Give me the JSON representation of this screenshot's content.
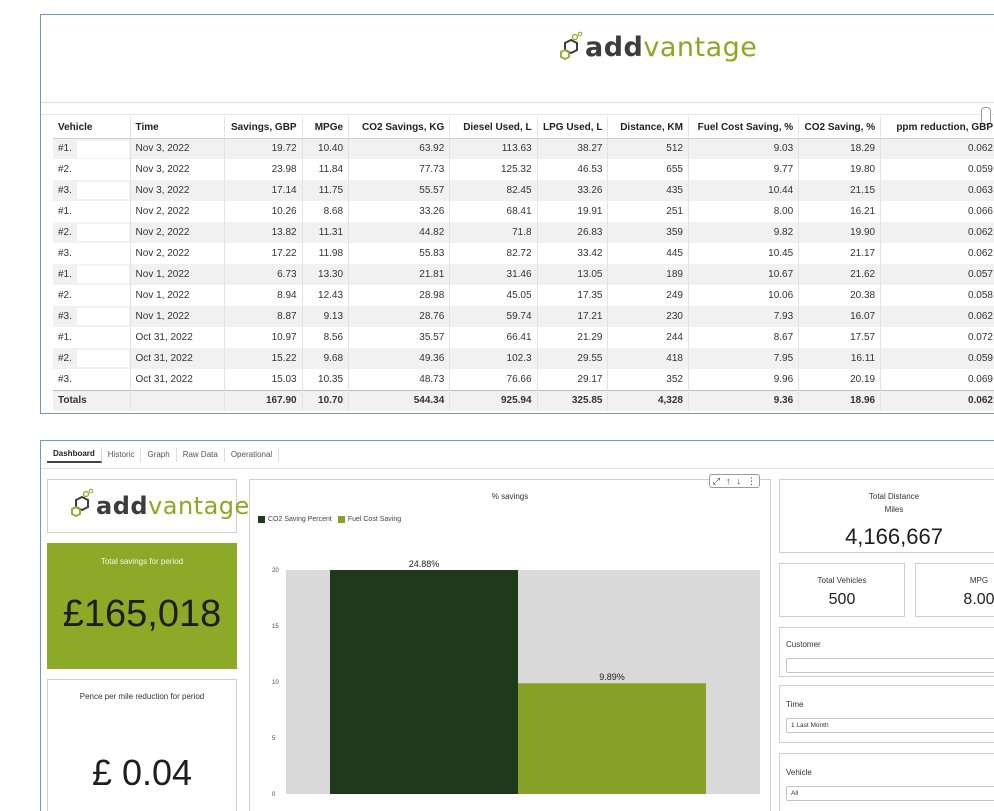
{
  "brand": {
    "word_part1": "add",
    "word_part2": "vantage",
    "accent": "#8ca823",
    "dark_green": "#1f3a1a"
  },
  "table": {
    "columns": [
      "Vehicle",
      "Time",
      "Savings, GBP",
      "MPGe",
      "CO2 Savings, KG",
      "Diesel Used, L",
      "LPG Used, L",
      "Distance, KM",
      "Fuel Cost Saving, %",
      "CO2 Saving, %",
      "ppm reduction, GBP"
    ],
    "rows": [
      [
        "#1.",
        "Nov 3, 2022",
        "19.72",
        "10.40",
        "63.92",
        "113.63",
        "38.27",
        "512",
        "9.03",
        "18.29",
        "0.062"
      ],
      [
        "#2.",
        "Nov 3, 2022",
        "23.98",
        "11.84",
        "77.73",
        "125.32",
        "46.53",
        "655",
        "9.77",
        "19.80",
        "0.059"
      ],
      [
        "#3.",
        "Nov 3, 2022",
        "17.14",
        "11.75",
        "55.57",
        "82.45",
        "33.26",
        "435",
        "10.44",
        "21.15",
        "0.063"
      ],
      [
        "#1.",
        "Nov 2, 2022",
        "10.26",
        "8.68",
        "33.26",
        "68.41",
        "19.91",
        "251",
        "8.00",
        "16.21",
        "0.066"
      ],
      [
        "#2.",
        "Nov 2, 2022",
        "13.82",
        "11.31",
        "44.82",
        "71.8",
        "26.83",
        "359",
        "9.82",
        "19.90",
        "0.062"
      ],
      [
        "#3.",
        "Nov 2, 2022",
        "17.22",
        "11.98",
        "55.83",
        "82.72",
        "33.42",
        "445",
        "10.45",
        "21.17",
        "0.062"
      ],
      [
        "#1.",
        "Nov 1, 2022",
        "6.73",
        "13.30",
        "21.81",
        "31.46",
        "13.05",
        "189",
        "10.67",
        "21.62",
        "0.057"
      ],
      [
        "#2.",
        "Nov 1, 2022",
        "8.94",
        "12.43",
        "28.98",
        "45.05",
        "17.35",
        "249",
        "10.06",
        "20.38",
        "0.058"
      ],
      [
        "#3.",
        "Nov 1, 2022",
        "8.87",
        "9.13",
        "28.76",
        "59.74",
        "17.21",
        "230",
        "7.93",
        "16.07",
        "0.062"
      ],
      [
        "#1.",
        "Oct 31, 2022",
        "10.97",
        "8.56",
        "35.57",
        "66.41",
        "21.29",
        "244",
        "8.67",
        "17.57",
        "0.072"
      ],
      [
        "#2.",
        "Oct 31, 2022",
        "15.22",
        "9.68",
        "49.36",
        "102.3",
        "29.55",
        "418",
        "7.95",
        "16.11",
        "0.059"
      ],
      [
        "#3.",
        "Oct 31, 2022",
        "15.03",
        "10.35",
        "48.73",
        "76.66",
        "29.17",
        "352",
        "9.96",
        "20.19",
        "0.069"
      ]
    ],
    "totals": [
      "Totals",
      "",
      "167.90",
      "10.70",
      "544.34",
      "925.94",
      "325.85",
      "4,328",
      "9.36",
      "18.96",
      "0.062"
    ]
  },
  "dashboard": {
    "tabs": [
      "Dashboard",
      "Historic",
      "Graph",
      "Raw Data",
      "Operational"
    ],
    "active_tab": "Dashboard",
    "total_savings_label": "Total savings for period",
    "total_savings_value": "£165,018",
    "pence_label": "Pence per mile reduction for period",
    "pence_value": "£ 0.04",
    "total_distance_label": "Total Distance",
    "total_distance_unit": "Miles",
    "total_distance_value": "4,166,667",
    "total_vehicles_label": "Total Vehicles",
    "total_vehicles_value": "500",
    "mpg_label": "MPG",
    "mpg_value": "8.00",
    "customer_label": "Customer",
    "customer_value": "",
    "time_label": "Time",
    "time_value": "1 Last Month",
    "vehicle_label": "Vehicle",
    "vehicle_value": "All",
    "chart_toolbar": [
      "⤢",
      "↑",
      "↓",
      "⋮"
    ]
  },
  "chart_data": {
    "type": "bar",
    "title": "% savings",
    "categories": [
      ""
    ],
    "series": [
      {
        "name": "CO2 Saving Percent",
        "values": [
          24.88
        ],
        "label": "24.88%",
        "color": "#1f3a1a"
      },
      {
        "name": "Fuel Cost Saving",
        "values": [
          9.89
        ],
        "label": "9.89%",
        "color": "#87a128"
      }
    ],
    "yticks": [
      "20",
      "15",
      "10",
      "5",
      "0"
    ],
    "ylim": [
      0,
      20
    ],
    "grid": false,
    "legend": "top-left"
  }
}
